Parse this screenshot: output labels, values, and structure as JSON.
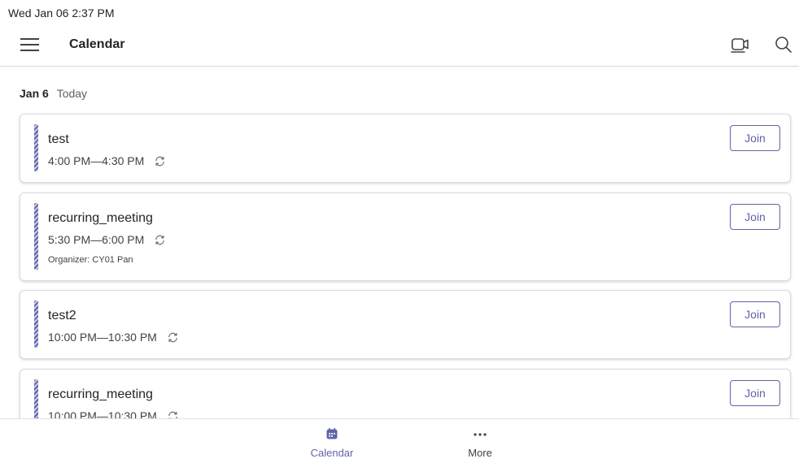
{
  "status_bar": {
    "datetime": "Wed Jan 06  2:37 PM"
  },
  "app_bar": {
    "title": "Calendar",
    "icons": [
      "menu-icon",
      "meet-now-icon",
      "search-icon"
    ]
  },
  "day": {
    "date": "Jan 6",
    "label": "Today"
  },
  "events": [
    {
      "title": "test",
      "time": "4:00 PM—4:30 PM",
      "recurring": true,
      "organizer": "",
      "join_label": "Join"
    },
    {
      "title": "recurring_meeting",
      "time": "5:30 PM—6:00 PM",
      "recurring": true,
      "organizer": "Organizer: CY01 Pan",
      "join_label": "Join"
    },
    {
      "title": "test2",
      "time": "10:00 PM—10:30 PM",
      "recurring": true,
      "organizer": "",
      "join_label": "Join"
    },
    {
      "title": "recurring_meeting",
      "time": "10:00 PM—10:30 PM",
      "recurring": true,
      "organizer": "",
      "join_label": "Join"
    }
  ],
  "bottom_nav": {
    "items": [
      {
        "label": "Calendar",
        "icon": "calendar-icon",
        "active": true
      },
      {
        "label": "More",
        "icon": "more-icon",
        "active": false
      }
    ]
  },
  "colors": {
    "accent": "#6264a7",
    "text": "#242424",
    "secondary_text": "#616161",
    "divider": "#d6d6d6"
  }
}
